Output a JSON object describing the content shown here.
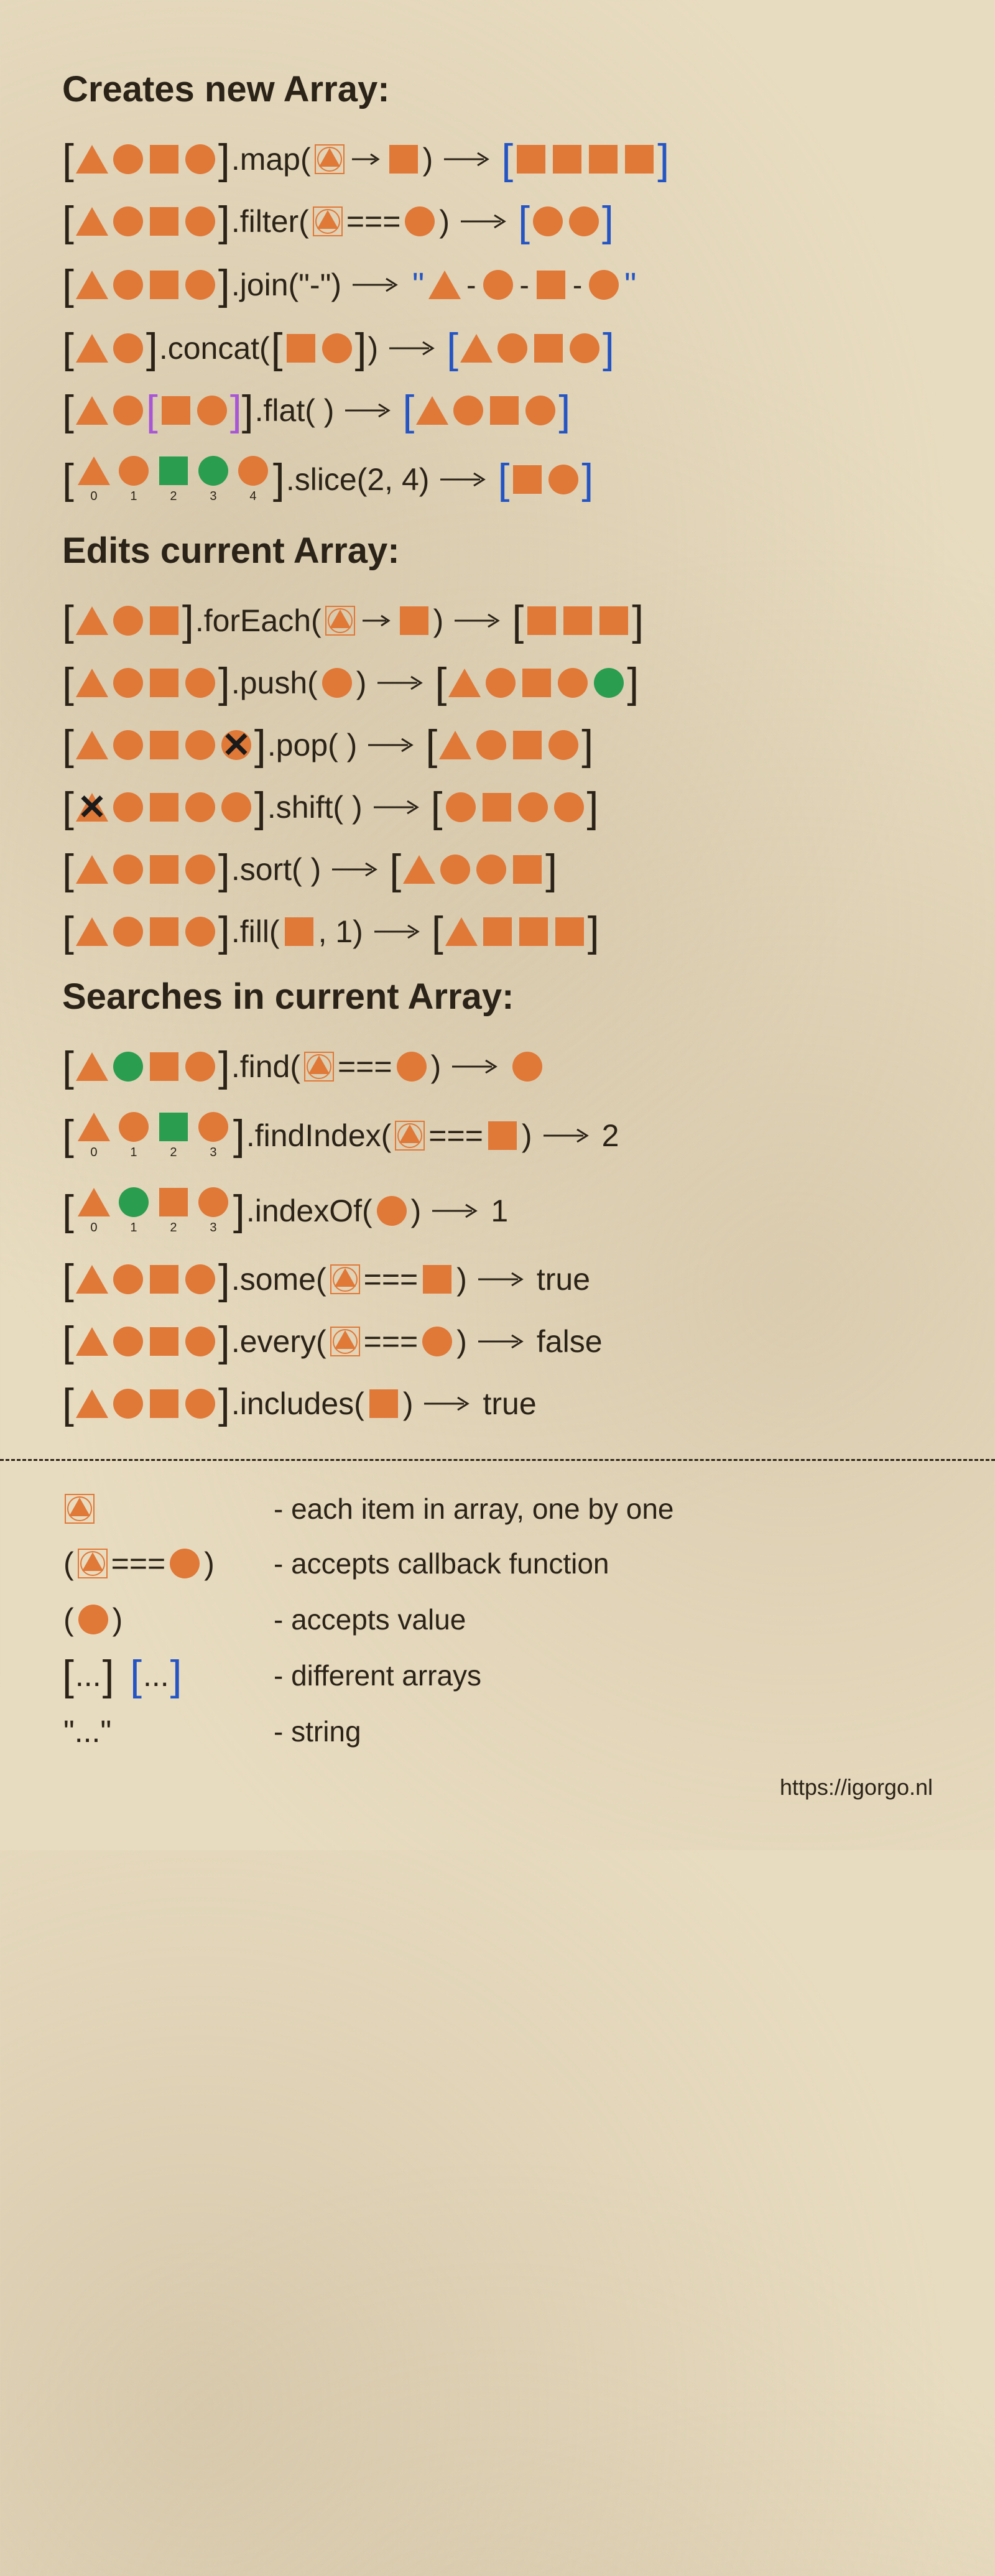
{
  "sections": {
    "creates": "Creates new Array:",
    "edits": "Edits current Array:",
    "searches": "Searches in current Array:"
  },
  "methods": {
    "map": ".map(",
    "filter": ".filter(",
    "join": ".join(\"-\")",
    "concat": ".concat(",
    "flat": ".flat( )",
    "slice": ".slice(2, 4)",
    "forEach": ".forEach(",
    "push": ".push(",
    "pop": ".pop( )",
    "shift": ".shift( )",
    "sort": ".sort( )",
    "fill": ".fill(",
    "find": ".find(",
    "findIndex": ".findIndex(",
    "indexOf": ".indexOf(",
    "some": ".some(",
    "every": ".every(",
    "includes": ".includes("
  },
  "text": {
    "eq": "===",
    "close": ")",
    "fillArgs": ", 1)",
    "idx0": "0",
    "idx1": "1",
    "idx2": "2",
    "idx3": "3",
    "idx4": "4",
    "r_findIndex": "2",
    "r_indexOf": "1",
    "r_some": "true",
    "r_every": "false",
    "r_includes": "true",
    "dots": "...",
    "dashSep": "-"
  },
  "legend": {
    "item": "- each item in array, one by one",
    "callback": "- accepts callback function",
    "value": "- accepts value",
    "arrays": "- different arrays",
    "string": "- string",
    "strQuote": "\"...\""
  },
  "url": "https://igorgo.nl"
}
